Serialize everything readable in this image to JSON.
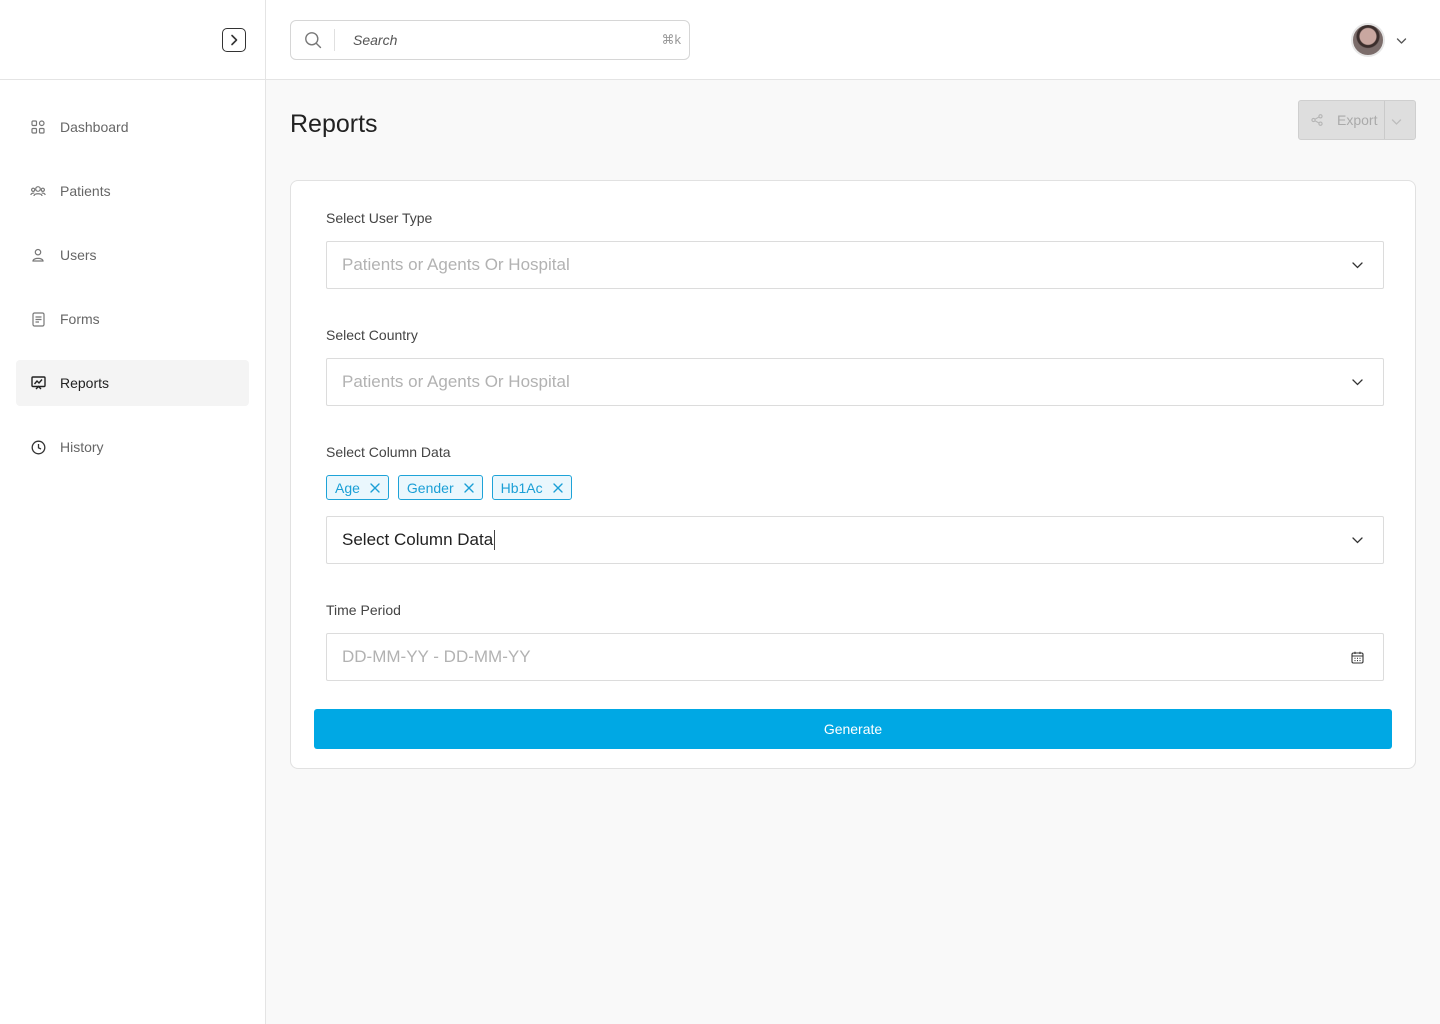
{
  "search": {
    "placeholder": "Search",
    "shortcut": "⌘k"
  },
  "sidebar": {
    "items": [
      {
        "label": "Dashboard",
        "icon": "grid-icon"
      },
      {
        "label": "Patients",
        "icon": "users-group-icon"
      },
      {
        "label": "Users",
        "icon": "user-icon"
      },
      {
        "label": "Forms",
        "icon": "document-icon"
      },
      {
        "label": "Reports",
        "icon": "report-icon",
        "active": true
      },
      {
        "label": "History",
        "icon": "clock-icon"
      }
    ]
  },
  "page": {
    "title": "Reports"
  },
  "toolbar": {
    "export_label": "Export"
  },
  "form": {
    "user_type": {
      "label": "Select User Type",
      "placeholder": "Patients or Agents Or Hospital"
    },
    "country": {
      "label": "Select Country",
      "placeholder": "Patients or Agents Or Hospital"
    },
    "column_data": {
      "label": "Select Column Data",
      "value": "Select Column Data",
      "tags": [
        "Age",
        "Gender",
        "Hb1Ac"
      ]
    },
    "time_period": {
      "label": "Time Period",
      "placeholder": "DD-MM-YY - DD-MM-YY"
    },
    "generate_label": "Generate"
  },
  "colors": {
    "accent": "#00a8e4",
    "tag_border": "#1ea3d8",
    "tag_bg": "#eaf7fd"
  }
}
